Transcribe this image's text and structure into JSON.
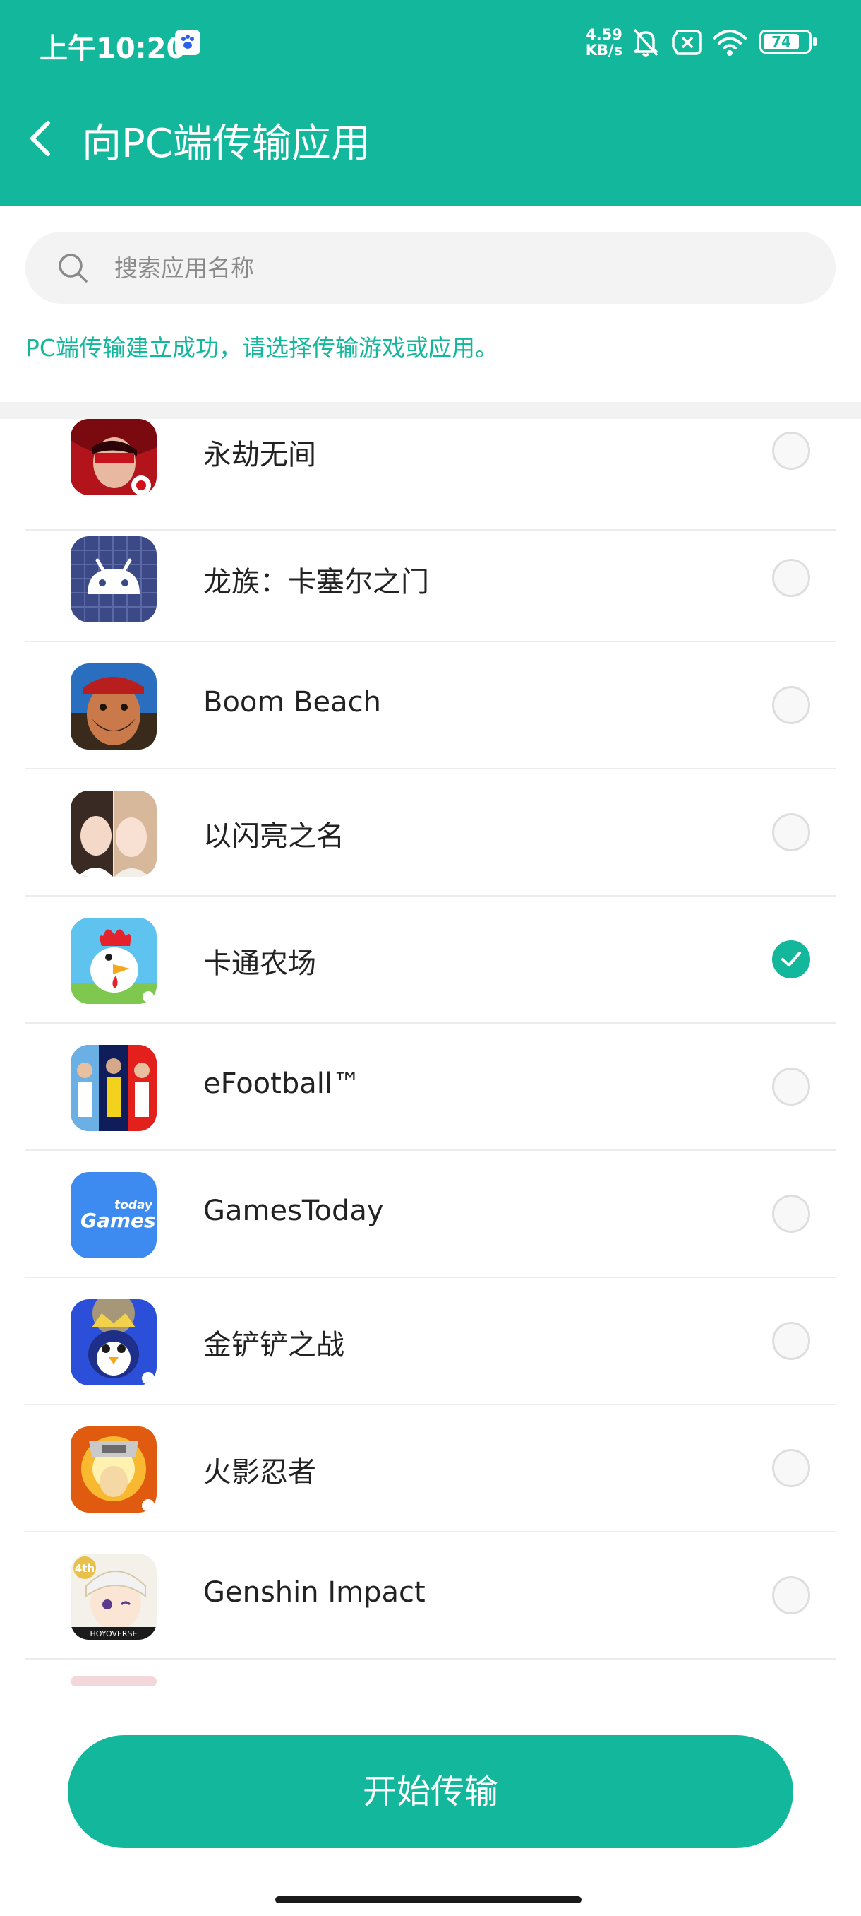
{
  "status_bar": {
    "time": "上午10:20",
    "net_speed": "4.59",
    "net_unit": "KB/s",
    "battery": "74"
  },
  "header": {
    "title": "向PC端传输应用"
  },
  "search": {
    "placeholder": "搜索应用名称"
  },
  "notice": "PC端传输建立成功，请选择传输游戏或应用。",
  "apps": [
    {
      "name": "永劫无间",
      "selected": false
    },
    {
      "name": "龙族：卡塞尔之门",
      "selected": false
    },
    {
      "name": "Boom Beach",
      "selected": false
    },
    {
      "name": "以闪亮之名",
      "selected": false
    },
    {
      "name": "卡通农场",
      "selected": true
    },
    {
      "name": "eFootball™",
      "selected": false
    },
    {
      "name": "GamesToday",
      "selected": false
    },
    {
      "name": "金铲铲之战",
      "selected": false
    },
    {
      "name": "火影忍者",
      "selected": false
    },
    {
      "name": "Genshin Impact",
      "selected": false
    }
  ],
  "icon_badges": {
    "gamestoday_small": "today",
    "gamestoday_big": "Games",
    "genshin_badge": "4th",
    "genshin_footer": "HOYOVERSE"
  },
  "actions": {
    "start_transfer": "开始传输"
  },
  "colors": {
    "accent": "#13b79c",
    "page_bg": "#ffffff",
    "divider": "#f2f2f2"
  }
}
